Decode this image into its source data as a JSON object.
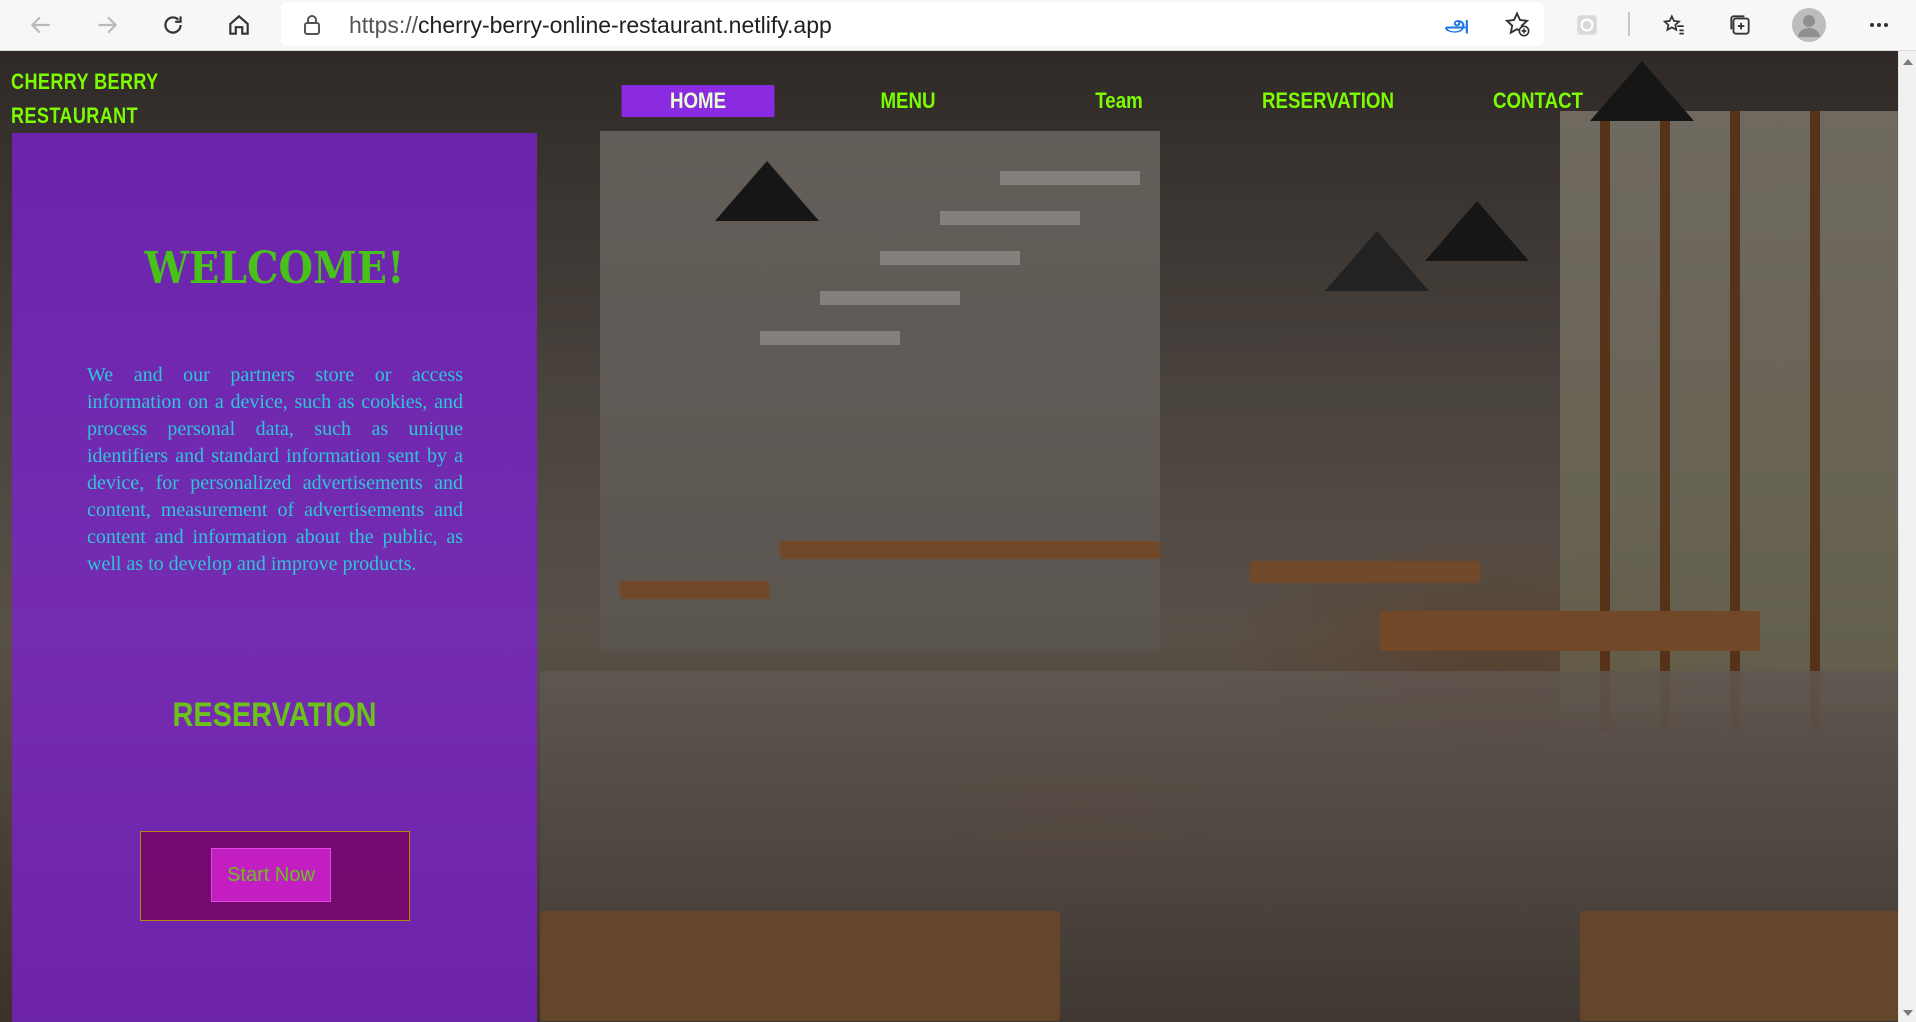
{
  "browser": {
    "url_protocol": "https://",
    "url_host": "cherry-berry-online-restaurant.netlify.app"
  },
  "site": {
    "brand_line1": "CHERRY BERRY",
    "brand_line2": "RESTAURANT",
    "nav": [
      {
        "label": "HOME",
        "active": true
      },
      {
        "label": "MENU",
        "active": false
      },
      {
        "label": "Team",
        "active": false
      },
      {
        "label": "RESERVATION",
        "active": false
      },
      {
        "label": "CONTACT",
        "active": false
      }
    ]
  },
  "hero": {
    "welcome": "WELCOME!",
    "paragraph": "We and our partners store or access information on a device, such as cookies, and process personal data, such as unique identifiers and standard information sent by a device, for personalized advertisements and content, measurement of advertisements and content and information about the public, as well as to develop and improve products.",
    "reservation_heading": "RESERVATION",
    "start_button": "Start Now"
  },
  "colors": {
    "accent_green": "#7cfc00",
    "panel_purple": "#801edc",
    "active_nav": "#8a2be2",
    "paragraph_text": "#2ec6d6"
  },
  "icons": [
    "back-icon",
    "forward-icon",
    "refresh-icon",
    "home-icon",
    "lock-icon",
    "read-aloud-icon",
    "add-favorite-icon",
    "extension-icon",
    "favorites-icon",
    "collections-icon",
    "profile-avatar",
    "more-icon"
  ]
}
